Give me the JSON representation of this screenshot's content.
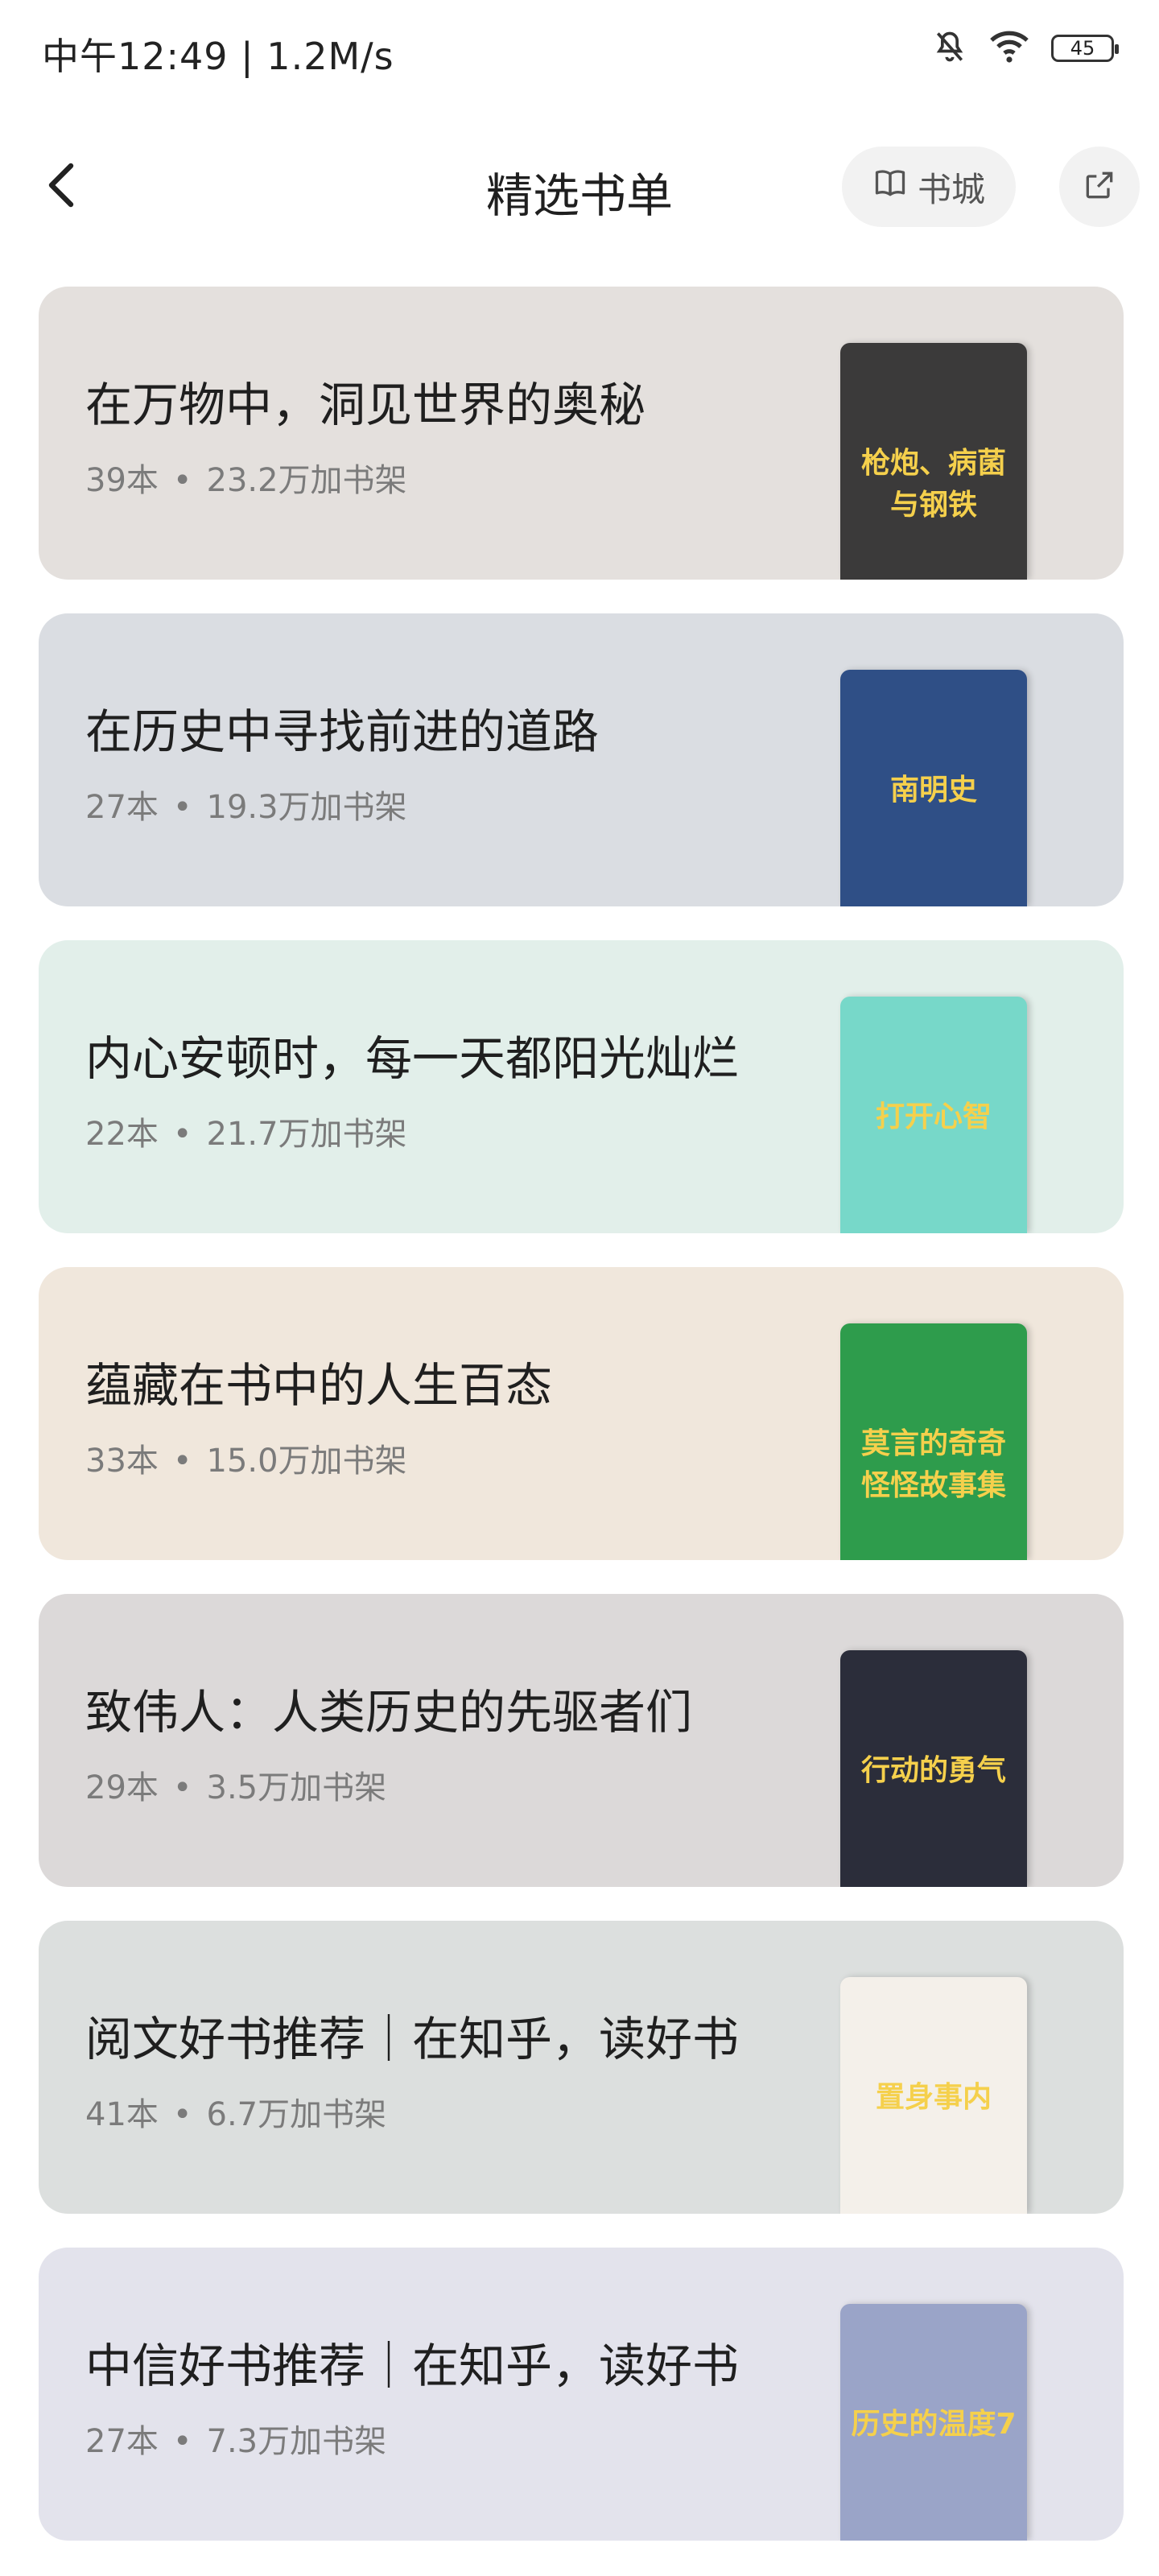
{
  "status": {
    "time_speed": "中午12:49 | 1.2M/s",
    "battery": "45"
  },
  "header": {
    "title": "精选书单",
    "store_label": "书城"
  },
  "cards": [
    {
      "title": "在万物中，洞见世界的奥秘",
      "count": "39本",
      "shelf": "23.2万加书架",
      "bg": "#e4e0dd",
      "covers": [
        "#3b3a3a",
        "#e9e9e9",
        "#2e4a74"
      ],
      "cover_text": "枪炮、病菌与钢铁"
    },
    {
      "title": "在历史中寻找前进的道路",
      "count": "27本",
      "shelf": "19.3万加书架",
      "bg": "#dadde2",
      "covers": [
        "#2f4f86",
        "#d84b3c",
        "#e6553c"
      ],
      "cover_text": "南明史"
    },
    {
      "title": "内心安顿时，每一天都阳光灿烂",
      "count": "22本",
      "shelf": "21.7万加书架",
      "bg": "#e2efea",
      "covers": [
        "#77d8c9",
        "#f3d640",
        "#d53a3a"
      ],
      "cover_text": "打开心智"
    },
    {
      "title": "蕴藏在书中的人生百态",
      "count": "33本",
      "shelf": "15.0万加书架",
      "bg": "#f0e7dc",
      "covers": [
        "#2e9c4c",
        "#f7f3ea",
        "#e9dcc6"
      ],
      "cover_text": "莫言的奇奇怪怪故事集"
    },
    {
      "title": "致伟人：人类历史的先驱者们",
      "count": "29本",
      "shelf": "3.5万加书架",
      "bg": "#dcd9d9",
      "covers": [
        "#2b2d3a",
        "#2f8fd8",
        "#f2f2f2"
      ],
      "cover_text": "行动的勇气"
    },
    {
      "title": "阅文好书推荐｜在知乎，读好书",
      "count": "41本",
      "shelf": "6.7万加书架",
      "bg": "#dcdfde",
      "covers": [
        "#f4f0ea",
        "#d9a68f",
        "#f1f1f1"
      ],
      "cover_text": "置身事内"
    },
    {
      "title": "中信好书推荐｜在知乎，读好书",
      "count": "27本",
      "shelf": "7.3万加书架",
      "bg": "#e3e3ec",
      "covers": [
        "#9aa4c8",
        "#f3cf4e",
        "#111111"
      ],
      "cover_text": "历史的温度7"
    }
  ],
  "icons": {
    "back": "chevron-left-icon",
    "store": "book-icon",
    "share": "share-icon",
    "mute": "bell-off-icon",
    "wifi": "wifi-icon"
  }
}
